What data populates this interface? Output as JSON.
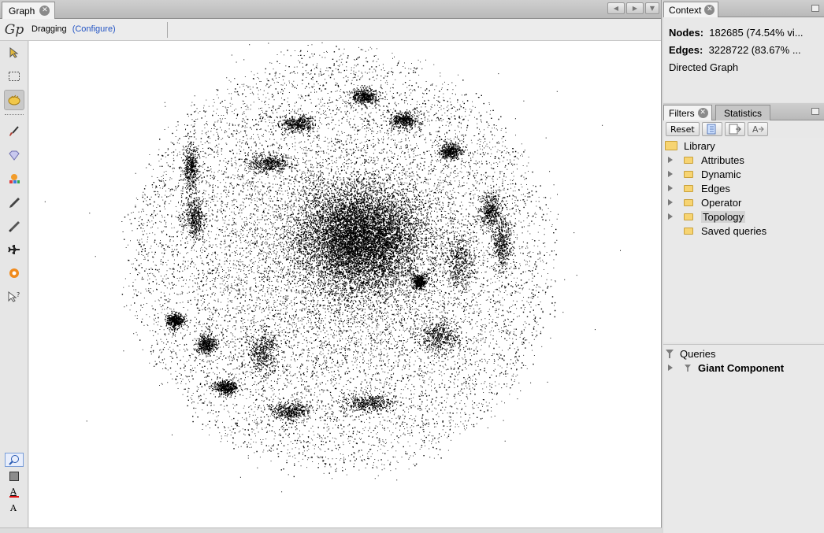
{
  "graph_window": {
    "tab_label": "Graph",
    "tool_name": "Dragging",
    "configure_link": "(Configure)",
    "logo_text": "Gp",
    "left_tools": [
      {
        "name": "selection-arrow-icon",
        "glyph": "➚"
      },
      {
        "name": "rectangle-select-icon",
        "glyph": "⬚"
      },
      {
        "name": "drag-hand-icon",
        "glyph": "✋",
        "active": true
      },
      {
        "name": "painter-brush-icon",
        "glyph": "🖌"
      },
      {
        "name": "diamond-size-icon",
        "glyph": "◇"
      },
      {
        "name": "heatmap-icon",
        "glyph": "⚙"
      },
      {
        "name": "pencil-icon",
        "glyph": "✎"
      },
      {
        "name": "edge-pencil-icon",
        "glyph": "✎"
      },
      {
        "name": "shortest-path-plane-icon",
        "glyph": "✈"
      },
      {
        "name": "sunflower-icon",
        "glyph": "✿"
      },
      {
        "name": "pointer-help-icon",
        "glyph": "⇖?"
      }
    ],
    "bottom_tools": [
      {
        "name": "zoom-fit-icon",
        "glyph": "⊕",
        "active": true
      },
      {
        "name": "background-color-icon",
        "glyph": "■"
      },
      {
        "name": "node-label-color-icon",
        "glyph": "A"
      },
      {
        "name": "label-font-icon",
        "glyph": "A"
      }
    ]
  },
  "context": {
    "tab_label": "Context",
    "nodes_label": "Nodes:",
    "nodes_value": "182685 (74.54% vi...",
    "edges_label": "Edges:",
    "edges_value": "3228722 (83.67% ...",
    "graph_type": "Directed Graph"
  },
  "filters": {
    "tab_filters": "Filters",
    "tab_statistics": "Statistics",
    "reset_label": "Reset",
    "library_label": "Library",
    "library_items": [
      "Attributes",
      "Dynamic",
      "Edges",
      "Operator",
      "Topology",
      "Saved queries"
    ],
    "queries_label": "Queries",
    "query_items": [
      "Giant Component"
    ]
  },
  "colors": {
    "accent_link": "#2455c4",
    "folder": "#f7d472",
    "canvas_bg": "#ffffff",
    "node_color": "#000000"
  }
}
